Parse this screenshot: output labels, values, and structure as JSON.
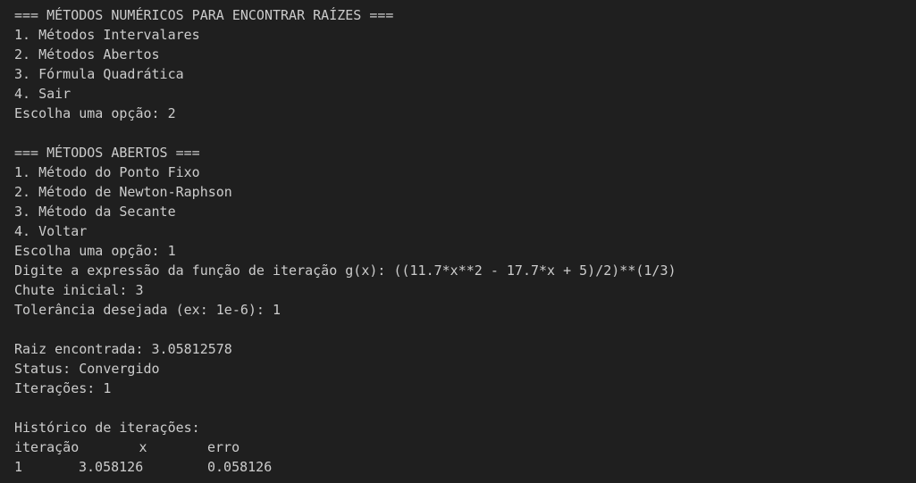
{
  "main_menu": {
    "title": "=== MÉTODOS NUMÉRICOS PARA ENCONTRAR RAÍZES ===",
    "options": [
      "1. Métodos Intervalares",
      "2. Métodos Abertos",
      "3. Fórmula Quadrática",
      "4. Sair"
    ],
    "prompt": "Escolha uma opção: 2"
  },
  "open_menu": {
    "title": "=== MÉTODOS ABERTOS ===",
    "options": [
      "1. Método do Ponto Fixo",
      "2. Método de Newton-Raphson",
      "3. Método da Secante",
      "4. Voltar"
    ],
    "prompt": "Escolha uma opção: 1"
  },
  "inputs": {
    "expression": "Digite a expressão da função de iteração g(x): ((11.7*x**2 - 17.7*x + 5)/2)**(1/3)",
    "initial_guess": "Chute inicial: 3",
    "tolerance": "Tolerância desejada (ex: 1e-6): 1"
  },
  "result": {
    "root": "Raiz encontrada: 3.05812578",
    "status": "Status: Convergido",
    "iterations": "Iterações: 1"
  },
  "history": {
    "title": "Histórico de iterações:",
    "headers": [
      "iteração",
      "x",
      "erro"
    ],
    "rows": [
      [
        "1",
        "3.058126",
        "0.058126"
      ]
    ]
  },
  "colors": {
    "background": "#1f1f1f",
    "text": "#cccccc"
  }
}
